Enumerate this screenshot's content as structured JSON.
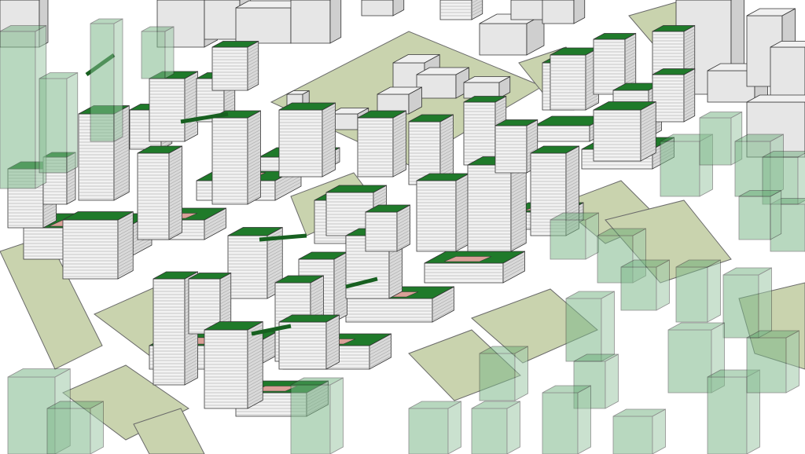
{
  "image": {
    "description_tag": "isometric-urban-massing-model",
    "colors": {
      "ground": "#ffffff",
      "park": "#c9d3ae",
      "park_dark": "#b4c099",
      "road": "#ffffff",
      "roof_green": "#1f7a2a",
      "roof_green_dark": "#176020",
      "wall_light": "#f2f2f2",
      "wall_shade": "#d9d9d9",
      "stripe": "#9a9a9a",
      "courtyard": "#d9a097",
      "glass": "#7fb98b",
      "glass_edge": "#2f6d3a",
      "grey_block": "#e6e6e6",
      "grey_block_shade": "#cfcfcf",
      "outline": "#333333"
    }
  }
}
